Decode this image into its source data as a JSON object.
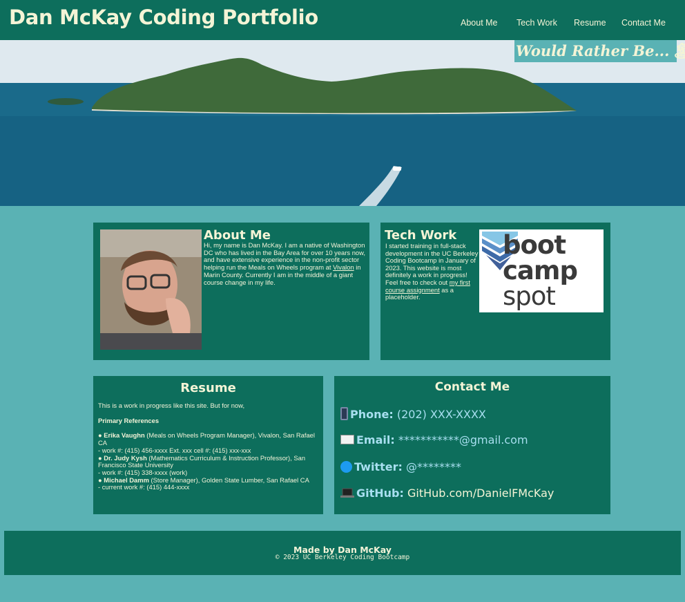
{
  "header": {
    "title": "Dan McKay Coding Portfolio",
    "nav": [
      "About Me",
      "Tech Work",
      "Resume",
      "Contact Me"
    ]
  },
  "hero": {
    "tagline": "Would Rather Be...",
    "tagline_icon": "palm-island-icon"
  },
  "about": {
    "heading": "About Me",
    "text_before_link": "Hi, my name is Dan McKay. I am a native of Washington DC who has lived in the Bay Area for over 10 years now, and have extensive experience in the non-profit sector helping run the Meals on Wheels program at ",
    "link": "Vivalon",
    "text_after_link": " in Marin County. Currently I am in the middle of a giant course change in my life."
  },
  "tech": {
    "heading": "Tech Work",
    "text_before_link": "I started training in full-stack development in the UC Berkeley Coding Bootcamp in January of 2023. This website is most definitely a work in progress! Feel free to check out ",
    "link": "my first course assignment",
    "text_after_link": " as a placeholder.",
    "logo_lines": [
      "boot",
      "camp",
      "spot"
    ]
  },
  "resume": {
    "heading": "Resume",
    "intro": "This is a work in progress like this site. But for now,",
    "refs_heading": "Primary References",
    "refs": [
      {
        "name": "Erika Vaughn",
        "detail": " (Meals on Wheels Program Manager), Vivalon, San Rafael CA",
        "contact": "- work #: (415) 456-xxxx Ext. xxx cell #: (415) xxx-xxx"
      },
      {
        "name": "Dr. Judy Kysh",
        "detail": " (Mathematics Curriculum & Instruction Professor), San Francisco State University",
        "contact": "- work #: (415) 338-xxxx (work)"
      },
      {
        "name": "Michael Damm",
        "detail": " (Store Manager), Golden State Lumber, San Rafael CA",
        "contact": "- current work #: (415) 444-xxxx"
      }
    ],
    "bullet": "●"
  },
  "contact": {
    "heading": "Contact Me",
    "phone_label": "Phone:",
    "phone_value": "(202) XXX-XXXX",
    "email_label": "Email:",
    "email_value": "***********@gmail.com",
    "twitter_label": "Twitter:",
    "twitter_value": "@********",
    "github_label": "GitHub:",
    "github_value": "GitHub.com/DanielFMcKay"
  },
  "footer": {
    "made_by": "Made by Dan McKay",
    "copyright": "© 2023 UC Berkeley Coding Bootcamp"
  },
  "colors": {
    "background": "#5ab2b4",
    "card": "#0d6e5c",
    "text": "#f4f4d6",
    "contact_accent": "#a8dff0"
  }
}
